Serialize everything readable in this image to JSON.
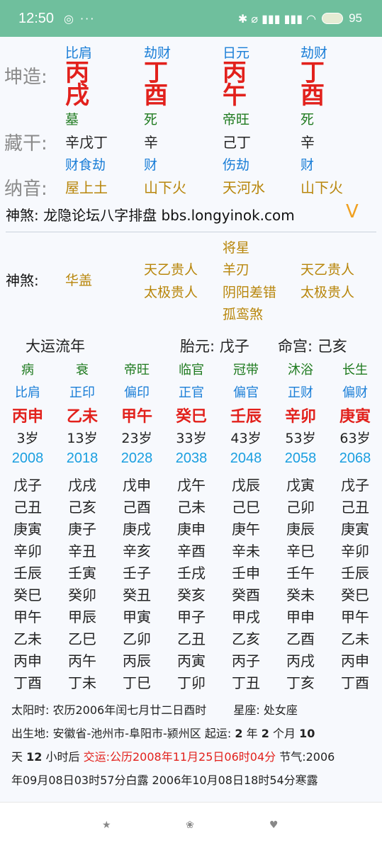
{
  "status": {
    "time": "12:50",
    "notif_icons": "◎ ···",
    "sys_icons": "✱ ⌀ ▮▮▮ ▮▮▮ ◠",
    "battery": "95"
  },
  "pillars": {
    "label_qiankun": "坤造:",
    "label_canggan": "藏干:",
    "label_nayin": "纳音:",
    "columns": [
      {
        "shishen": "比肩",
        "stem": "丙",
        "branch": "戌",
        "phase": "墓",
        "hidden": "辛戊丁",
        "hidden_shishen": "财食劫",
        "nayin": "屋上土"
      },
      {
        "shishen": "劫财",
        "stem": "丁",
        "branch": "酉",
        "phase": "死",
        "hidden": "辛",
        "hidden_shishen": "财",
        "nayin": "山下火"
      },
      {
        "shishen": "日元",
        "stem": "丙",
        "branch": "午",
        "phase": "帝旺",
        "hidden": "己丁",
        "hidden_shishen": "伤劫",
        "nayin": "天河水"
      },
      {
        "shishen": "劫财",
        "stem": "丁",
        "branch": "酉",
        "phase": "死",
        "hidden": "辛",
        "hidden_shishen": "财",
        "nayin": "山下火"
      }
    ]
  },
  "banner": {
    "text": "神煞:  龙隐论坛八字排盘 bbs.longyinok.com",
    "chevron": "V"
  },
  "shensha": {
    "label": "神煞:",
    "col1": [
      "华盖"
    ],
    "col2": [
      "天乙贵人",
      "太极贵人"
    ],
    "col3": [
      "将星",
      "羊刃",
      "阴阳差错",
      "孤鸾煞"
    ],
    "col4": [
      "天乙贵人",
      "太极贵人"
    ]
  },
  "dayun": {
    "title": "大运流年",
    "taiyuan": "胎元:  戊子",
    "minggong": "命宫:  己亥",
    "columns": [
      {
        "phase": "病",
        "shishen": "比肩",
        "ganzhi": "丙申",
        "age": "3岁",
        "year": "2008",
        "liunian": [
          "戊子",
          "己丑",
          "庚寅",
          "辛卯",
          "壬辰",
          "癸巳",
          "甲午",
          "乙未",
          "丙申",
          "丁酉"
        ]
      },
      {
        "phase": "衰",
        "shishen": "正印",
        "ganzhi": "乙未",
        "age": "13岁",
        "year": "2018",
        "liunian": [
          "戊戌",
          "己亥",
          "庚子",
          "辛丑",
          "壬寅",
          "癸卯",
          "甲辰",
          "乙巳",
          "丙午",
          "丁未"
        ]
      },
      {
        "phase": "帝旺",
        "shishen": "偏印",
        "ganzhi": "甲午",
        "age": "23岁",
        "year": "2028",
        "liunian": [
          "戊申",
          "己酉",
          "庚戌",
          "辛亥",
          "壬子",
          "癸丑",
          "甲寅",
          "乙卯",
          "丙辰",
          "丁巳"
        ]
      },
      {
        "phase": "临官",
        "shishen": "正官",
        "ganzhi": "癸巳",
        "age": "33岁",
        "year": "2038",
        "liunian": [
          "戊午",
          "己未",
          "庚申",
          "辛酉",
          "壬戌",
          "癸亥",
          "甲子",
          "乙丑",
          "丙寅",
          "丁卯"
        ]
      },
      {
        "phase": "冠带",
        "shishen": "偏官",
        "ganzhi": "壬辰",
        "age": "43岁",
        "year": "2048",
        "liunian": [
          "戊辰",
          "己巳",
          "庚午",
          "辛未",
          "壬申",
          "癸酉",
          "甲戌",
          "乙亥",
          "丙子",
          "丁丑"
        ]
      },
      {
        "phase": "沐浴",
        "shishen": "正财",
        "ganzhi": "辛卯",
        "age": "53岁",
        "year": "2058",
        "liunian": [
          "戊寅",
          "己卯",
          "庚辰",
          "辛巳",
          "壬午",
          "癸未",
          "甲申",
          "乙酉",
          "丙戌",
          "丁亥"
        ]
      },
      {
        "phase": "长生",
        "shishen": "偏财",
        "ganzhi": "庚寅",
        "age": "63岁",
        "year": "2068",
        "liunian": [
          "戊子",
          "己丑",
          "庚寅",
          "辛卯",
          "壬辰",
          "癸巳",
          "甲午",
          "乙未",
          "丙申",
          "丁酉"
        ]
      }
    ]
  },
  "info": {
    "solar_time": "太阳时:  农历2006年闰七月廿二日酉时",
    "zodiac": "星座:  处女座",
    "birthplace": "出生地:  安徽省-池州市-阜阳市-颍州区",
    "qiyun_label": "起运:",
    "qiyun_year": "2",
    "qiyun_year_unit": "年",
    "qiyun_month": "2",
    "qiyun_month_unit": "个月",
    "qiyun_day": "10",
    "day_unit": "天",
    "qiyun_hour": "12",
    "hour_unit": "小时后",
    "jiaoyun": "交运:公历2008年11月25日06时04分",
    "jieqi_1": "节气:2006",
    "jieqi_2": "年09月08日03时57分白露 2006年10月08日18时54分寒露"
  },
  "navbar": {
    "home": "★",
    "paw": "❀",
    "heart": "♥"
  }
}
